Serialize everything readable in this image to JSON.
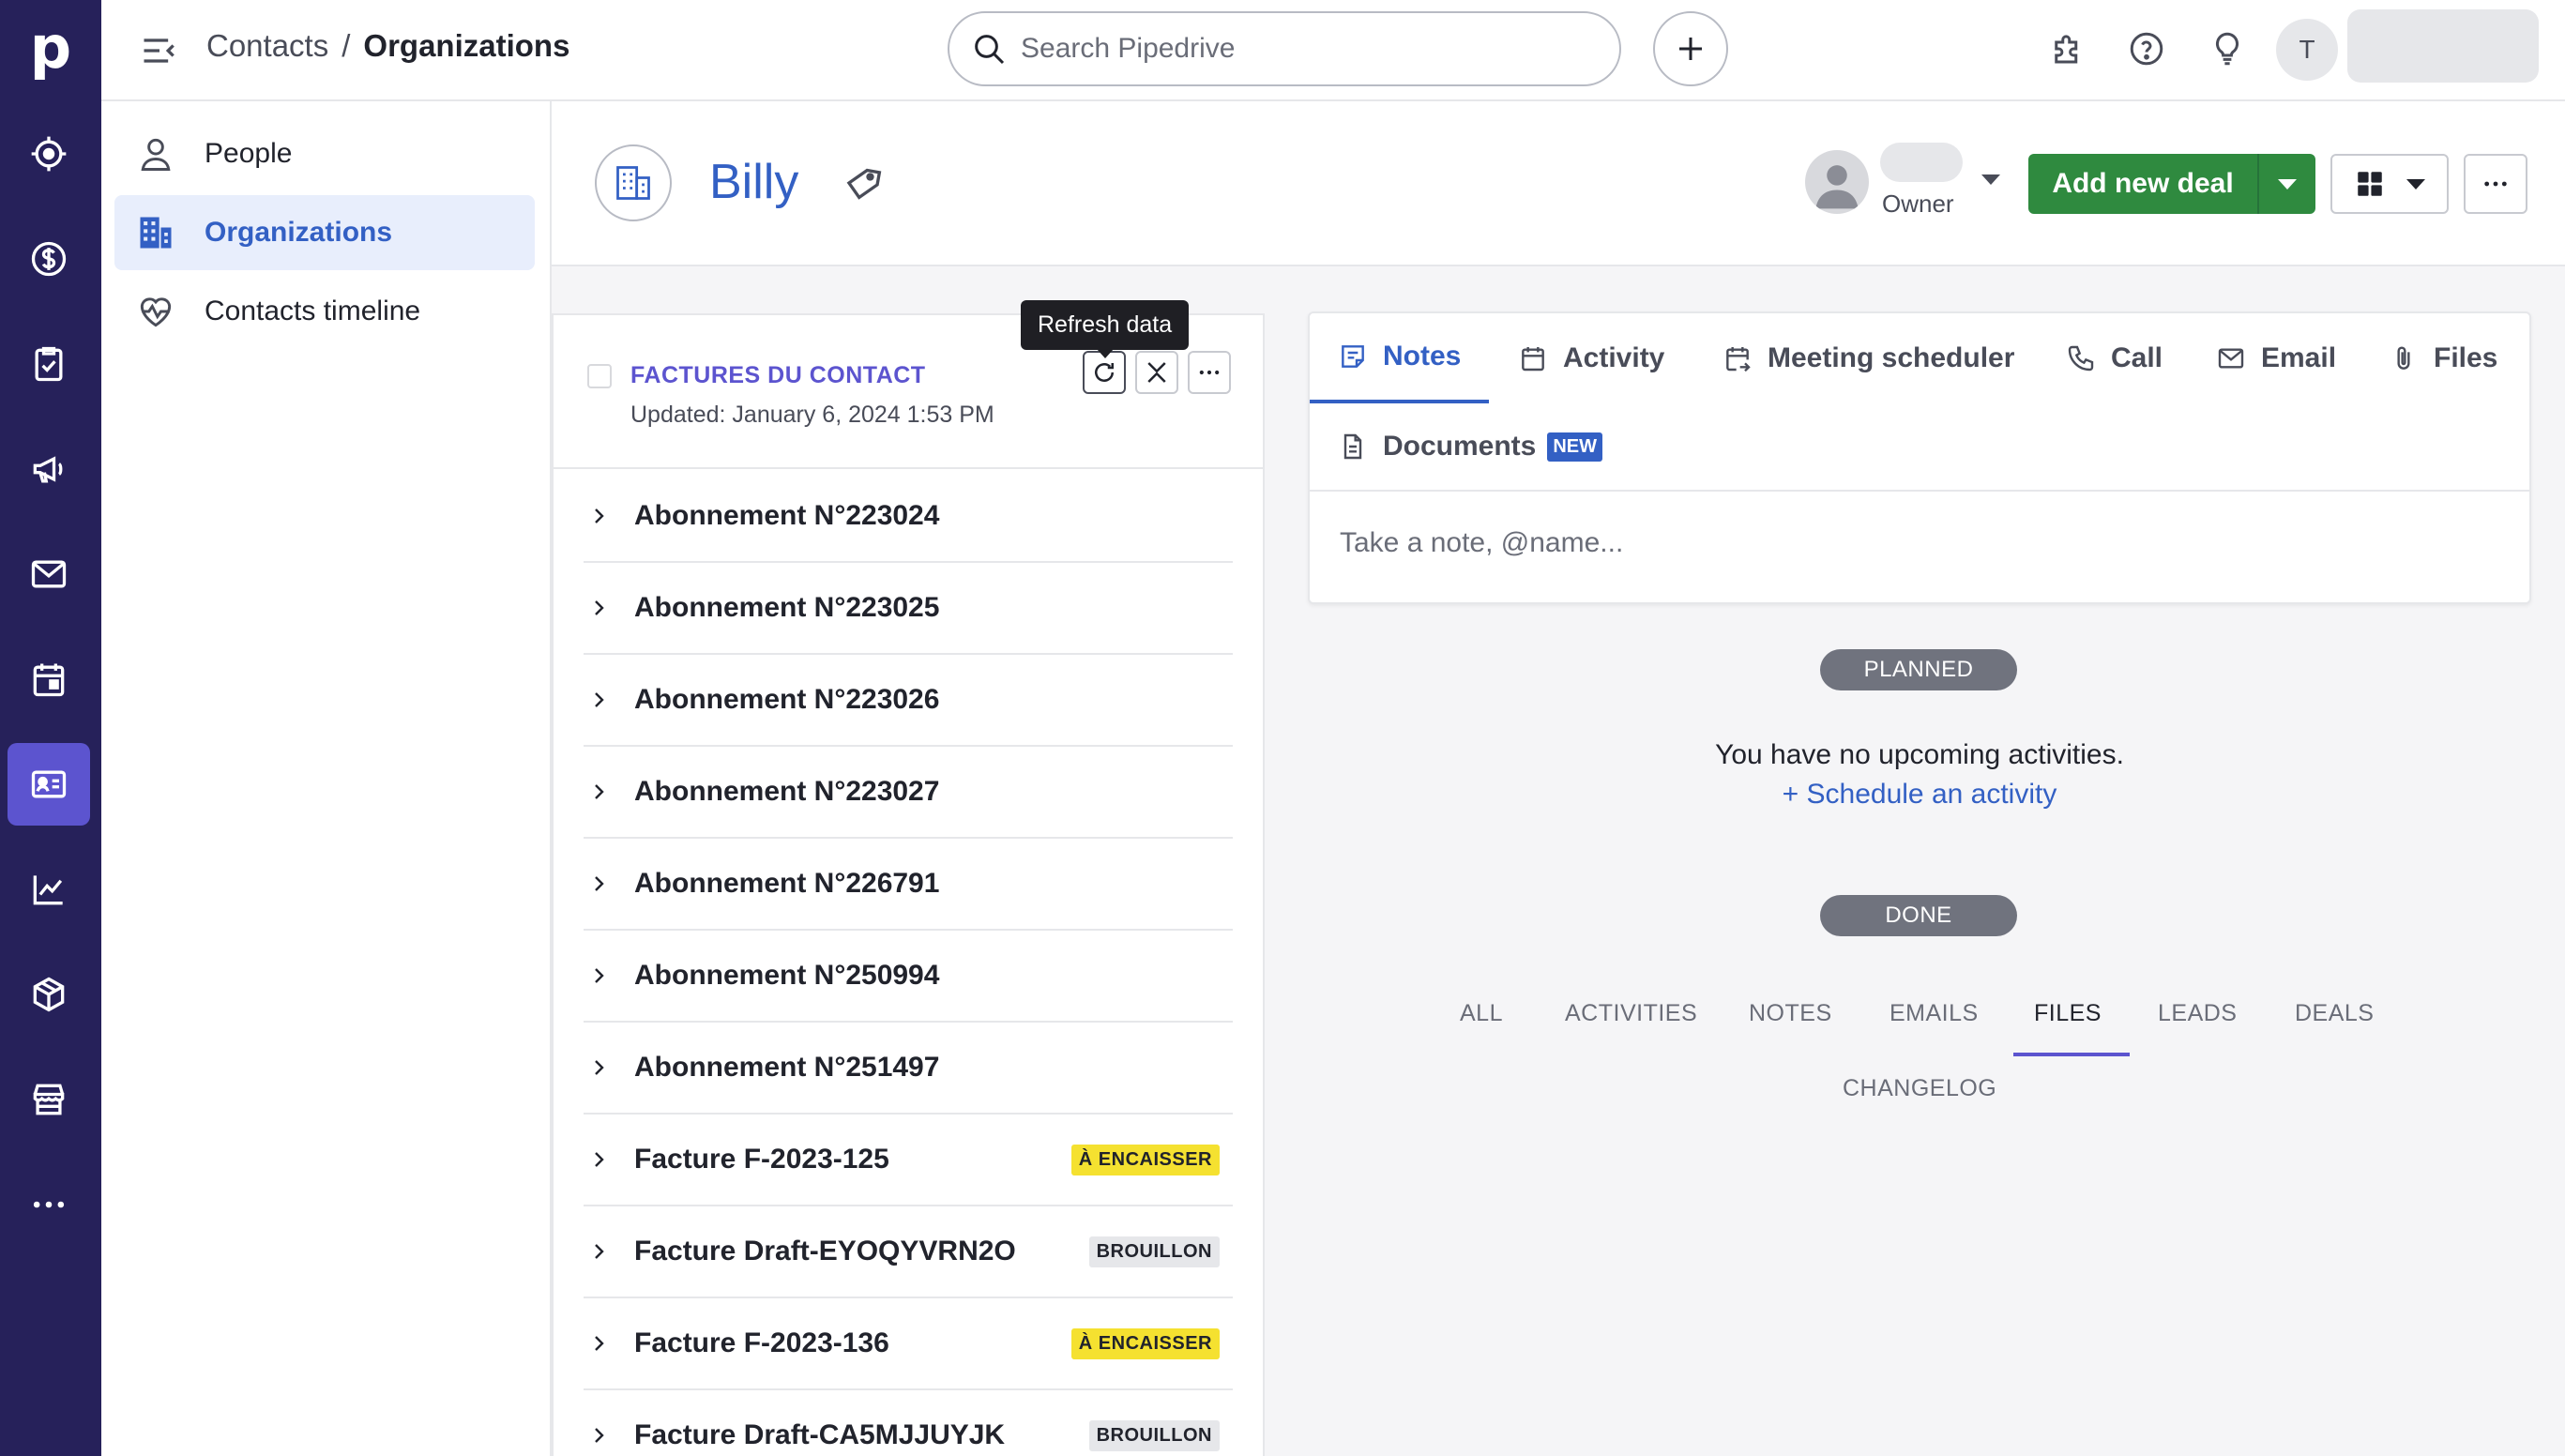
{
  "app": {
    "logo_letter": "p",
    "rail_icons": [
      "target-icon",
      "dollar-icon",
      "clipboard-check-icon",
      "megaphone-icon",
      "mail-icon",
      "calendar-icon",
      "contacts-card-icon",
      "chart-icon",
      "box-icon",
      "store-icon",
      "more-icon"
    ],
    "rail_active": "contacts-card-icon"
  },
  "topbar": {
    "breadcrumb_parent": "Contacts",
    "breadcrumb_sep": "/",
    "breadcrumb_current": "Organizations",
    "search_placeholder": "Search Pipedrive",
    "avatar_initial": "T"
  },
  "subnav": {
    "items": [
      {
        "label": "People",
        "icon": "person-icon"
      },
      {
        "label": "Organizations",
        "icon": "building-icon",
        "active": true
      },
      {
        "label": "Contacts timeline",
        "icon": "heart-pulse-icon"
      }
    ]
  },
  "header": {
    "org_name": "Billy",
    "owner_label": "Owner",
    "add_deal_label": "Add new deal"
  },
  "left_panel": {
    "title": "FACTURES DU CONTACT",
    "updated": "Updated: January 6, 2024 1:53 PM",
    "tooltip": "Refresh data",
    "rows": [
      {
        "label": "Abonnement N°223024",
        "badge": ""
      },
      {
        "label": "Abonnement N°223025",
        "badge": ""
      },
      {
        "label": "Abonnement N°223026",
        "badge": ""
      },
      {
        "label": "Abonnement N°223027",
        "badge": ""
      },
      {
        "label": "Abonnement N°226791",
        "badge": ""
      },
      {
        "label": "Abonnement N°250994",
        "badge": ""
      },
      {
        "label": "Abonnement N°251497",
        "badge": ""
      },
      {
        "label": "Facture F-2023-125",
        "badge": "À ENCAISSER",
        "badge_color": "#f5e130"
      },
      {
        "label": "Facture Draft-EYOQYVRN2O",
        "badge": "BROUILLON",
        "badge_color": "#e6e7ea"
      },
      {
        "label": "Facture F-2023-136",
        "badge": "À ENCAISSER",
        "badge_color": "#f5e130"
      },
      {
        "label": "Facture Draft-CA5MJJUYJK",
        "badge": "BROUILLON",
        "badge_color": "#e6e7ea"
      }
    ]
  },
  "composer": {
    "tabs": [
      {
        "label": "Notes",
        "icon": "note-icon",
        "active": true
      },
      {
        "label": "Activity",
        "icon": "calendar-icon"
      },
      {
        "label": "Meeting scheduler",
        "icon": "calendar-sync-icon"
      },
      {
        "label": "Call",
        "icon": "phone-icon"
      },
      {
        "label": "Email",
        "icon": "mail-icon"
      },
      {
        "label": "Files",
        "icon": "paperclip-icon"
      }
    ],
    "documents_tab": "Documents",
    "documents_badge": "NEW",
    "note_placeholder": "Take a note, @name..."
  },
  "timeline": {
    "planned_label": "PLANNED",
    "empty_message": "You have no upcoming activities.",
    "schedule_link": "+ Schedule an activity",
    "done_label": "DONE",
    "filters": [
      "ALL",
      "ACTIVITIES",
      "NOTES",
      "EMAILS",
      "FILES",
      "LEADS",
      "DEALS",
      "CHANGELOG"
    ],
    "active_filter": "FILES"
  },
  "colors": {
    "rail_bg": "#26215a",
    "rail_active": "#5c54cf",
    "accent_blue": "#3360c4",
    "deal_green": "#2f8a3f",
    "badge_yellow": "#f5e130"
  }
}
